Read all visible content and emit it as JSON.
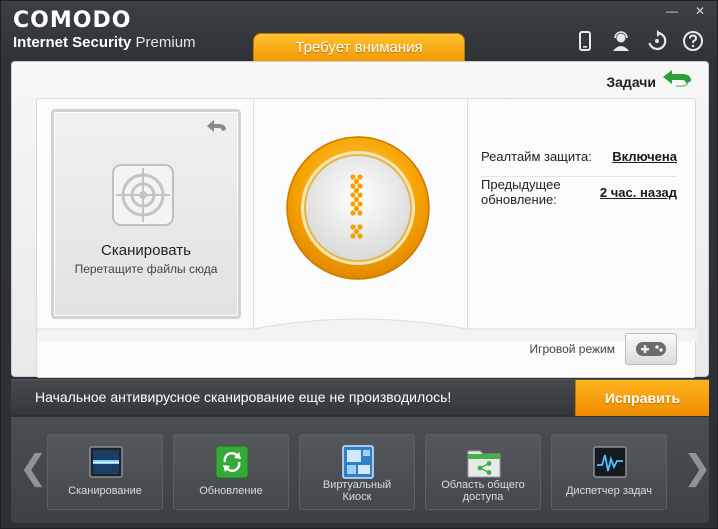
{
  "brand": {
    "logo": "COMODO",
    "product": "Internet Security",
    "edition": "Premium"
  },
  "window_controls": {
    "minimize": "—",
    "close": "✕"
  },
  "attention_tab": "Требует внимания",
  "tasks_label": "Задачи",
  "scan_tile": {
    "title": "Сканировать",
    "subtitle": "Перетащите файлы сюда"
  },
  "status": {
    "realtime_label": "Реалтайм защита:",
    "realtime_value": "Включена",
    "update_label_line1": "Предыдущее",
    "update_label_line2": "обновление:",
    "update_value": "2 час. назад"
  },
  "game_mode_label": "Игровой режим",
  "alert": {
    "message": "Начальное антивирусное сканирование еще не производилось!",
    "fix_label": "Исправить"
  },
  "toolbar": {
    "tiles": [
      {
        "label_line1": "Сканирование",
        "label_line2": ""
      },
      {
        "label_line1": "Обновление",
        "label_line2": ""
      },
      {
        "label_line1": "Виртуальный",
        "label_line2": "Киоск"
      },
      {
        "label_line1": "Область общего",
        "label_line2": "доступа"
      },
      {
        "label_line1": "Диспетчер задач",
        "label_line2": ""
      }
    ],
    "nav_left": "❮",
    "nav_right": "❯"
  },
  "colors": {
    "accent_orange": "#f39a00",
    "tasks_arrow_green": "#2e9e3a"
  }
}
